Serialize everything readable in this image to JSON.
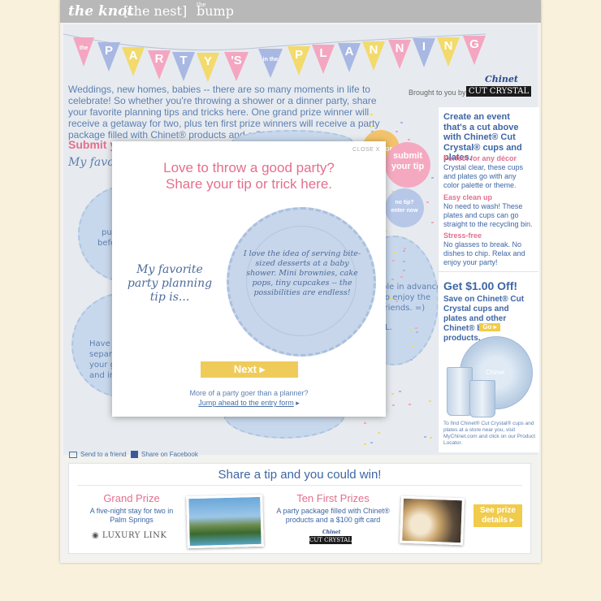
{
  "nav": {
    "brand1": "the knot",
    "brand2": "[the nest]",
    "brand3": "bump",
    "brand3_prefix": "the"
  },
  "banner": {
    "letters": [
      "the",
      "P",
      "A",
      "R",
      "T",
      "Y",
      "'S",
      "in the",
      "P",
      "L",
      "A",
      "N",
      "N",
      "I",
      "N",
      "G"
    ]
  },
  "intro": {
    "text": "Weddings, new homes, babies -- there are so many moments in life to celebrate! So whether you're throwing a shower or a dinner party, share your favorite planning tips and tricks here. One grand prize winner will receive a getaway for two, plus ten first prize winners will receive a party package filled with Chinet® products and a $100 gift card."
  },
  "sponsor": {
    "brought": "Brought to you by",
    "chinet": "Chinet",
    "cutcrystal": "CUT CRYSTAL"
  },
  "left": {
    "submit_heading": "Submit y",
    "fav_heading": "My favo",
    "plate_texts": [
      "put",
      "befo",
      "Have w",
      "separat",
      "your gu",
      "and in",
      "ble in advance",
      "to enjoy the",
      "friends. =)",
      "L."
    ]
  },
  "bubbles": {
    "more": "ore",
    "submit": "submit\nyour tip",
    "no_tip": "no tip?\nenter now"
  },
  "sidebar": {
    "title": "Create an event that's a cut above with Chinet® Cut Crystal® cups and plates.",
    "items": [
      {
        "heading": "Perfect for any décor",
        "body": "Crystal clear, these cups and plates go with any color palette or theme."
      },
      {
        "heading": "Easy clean up",
        "body": "No need to wash! These plates and cups can go straight to the recycling bin."
      },
      {
        "heading": "Stress-free",
        "body": "No glasses to break. No dishes to chip. Relax and enjoy your party!"
      }
    ],
    "coupon_title": "Get $1.00 Off!",
    "coupon_body": "Save on Chinet® Cut Crystal cups and plates and other Chinet® brand products.",
    "go_label": "Go",
    "find_note": "To find Chinet® Cut Crystal® cups and plates at a store near you, visit MyChinet.com and click on our Product Locator.",
    "product_label": "Chinet"
  },
  "modal": {
    "close": "CLOSE X",
    "title_line1": "Love to throw a good party?",
    "title_line2": "Share your tip or trick here.",
    "label": "My favorite party planning tip is...",
    "tip": "I love the idea of serving bite-sized desserts at a baby shower. Mini brownies, cake pops, tiny cupcakes -- the possibilities are endless!",
    "next": "Next",
    "foot": "More of a party goer than a planner?",
    "jump": "Jump ahead to the entry form"
  },
  "share": {
    "friend": "Send to a friend",
    "facebook": "Share on Facebook"
  },
  "prizes": {
    "title": "Share a tip and you could win!",
    "grand_title": "Grand Prize",
    "grand_text": "A five-night stay for two in Palm Springs",
    "grand_logo": "LUXURY LINK",
    "ten_title": "Ten First Prizes",
    "ten_text": "A party package filled with Chinet® products and a $100 gift card",
    "ten_logo_top": "Chinet",
    "ten_logo": "CUT CRYSTAL",
    "see_details": "See prize details"
  },
  "colors": {
    "pink": "#e46f8d",
    "blue": "#3d66a5",
    "yellow": "#f1cc4b",
    "flag_pink": "#f4a6c0",
    "flag_blue": "#a8b8e3",
    "flag_yellow": "#f2da6c"
  }
}
